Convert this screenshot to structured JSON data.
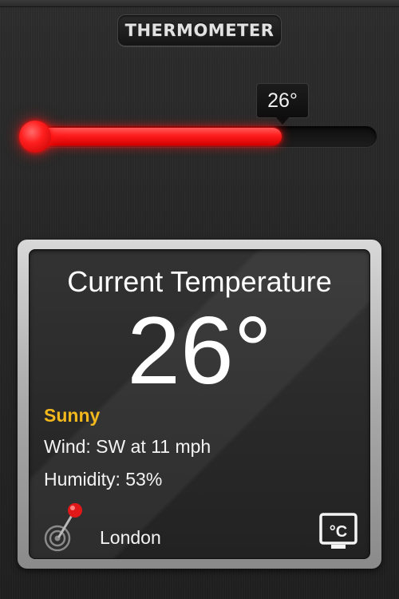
{
  "header": {
    "title": "THERMOMETER"
  },
  "slider": {
    "value_label": "26°",
    "fill_fraction": 0.73,
    "accent_color": "#ff1c1c"
  },
  "current": {
    "heading": "Current Temperature",
    "temperature": "26°",
    "condition": "Sunny",
    "condition_color": "#f2b81c",
    "wind": "Wind: SW at 11 mph",
    "humidity": "Humidity: 53%",
    "city": "London",
    "unit_label": "°C"
  },
  "icons": {
    "location": "location-pin-radar-icon",
    "unit_toggle": "celsius-display-icon"
  }
}
